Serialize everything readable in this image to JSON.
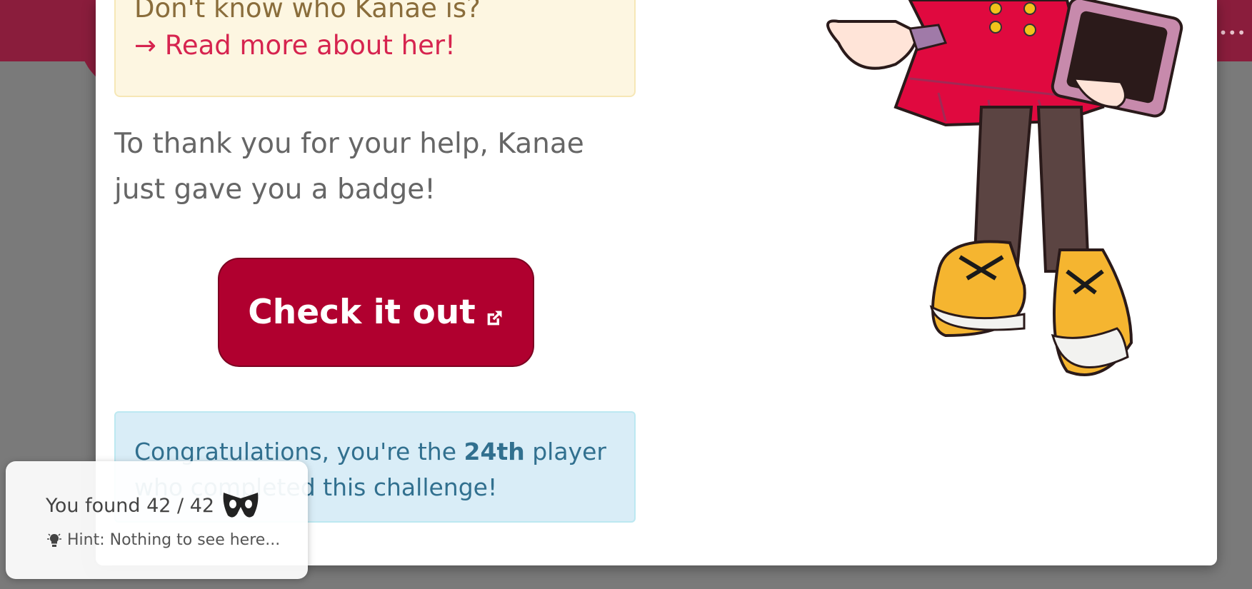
{
  "header": {
    "more_icon": "ellipsis-icon"
  },
  "notice": {
    "title": "Don't know who Kanae is?",
    "link_arrow": "→",
    "link_text": "Read more about her!"
  },
  "message": {
    "thanks": "To thank you for your help, Kanae just gave you a badge!"
  },
  "cta": {
    "label": "Check it out",
    "icon": "external-link-icon"
  },
  "congrats": {
    "prefix": "Congratulations, you're the ",
    "rank": "24th",
    "suffix": " player who completed this challenge!"
  },
  "toast": {
    "found_text": "You found 42 / 42",
    "hint_text": "Hint: Nothing to see here..."
  },
  "colors": {
    "brand": "#8a1d3c",
    "cta": "#b0002f",
    "link": "#d6244f",
    "warning_bg": "#fdf6e1",
    "info_bg": "#d9edf7"
  }
}
